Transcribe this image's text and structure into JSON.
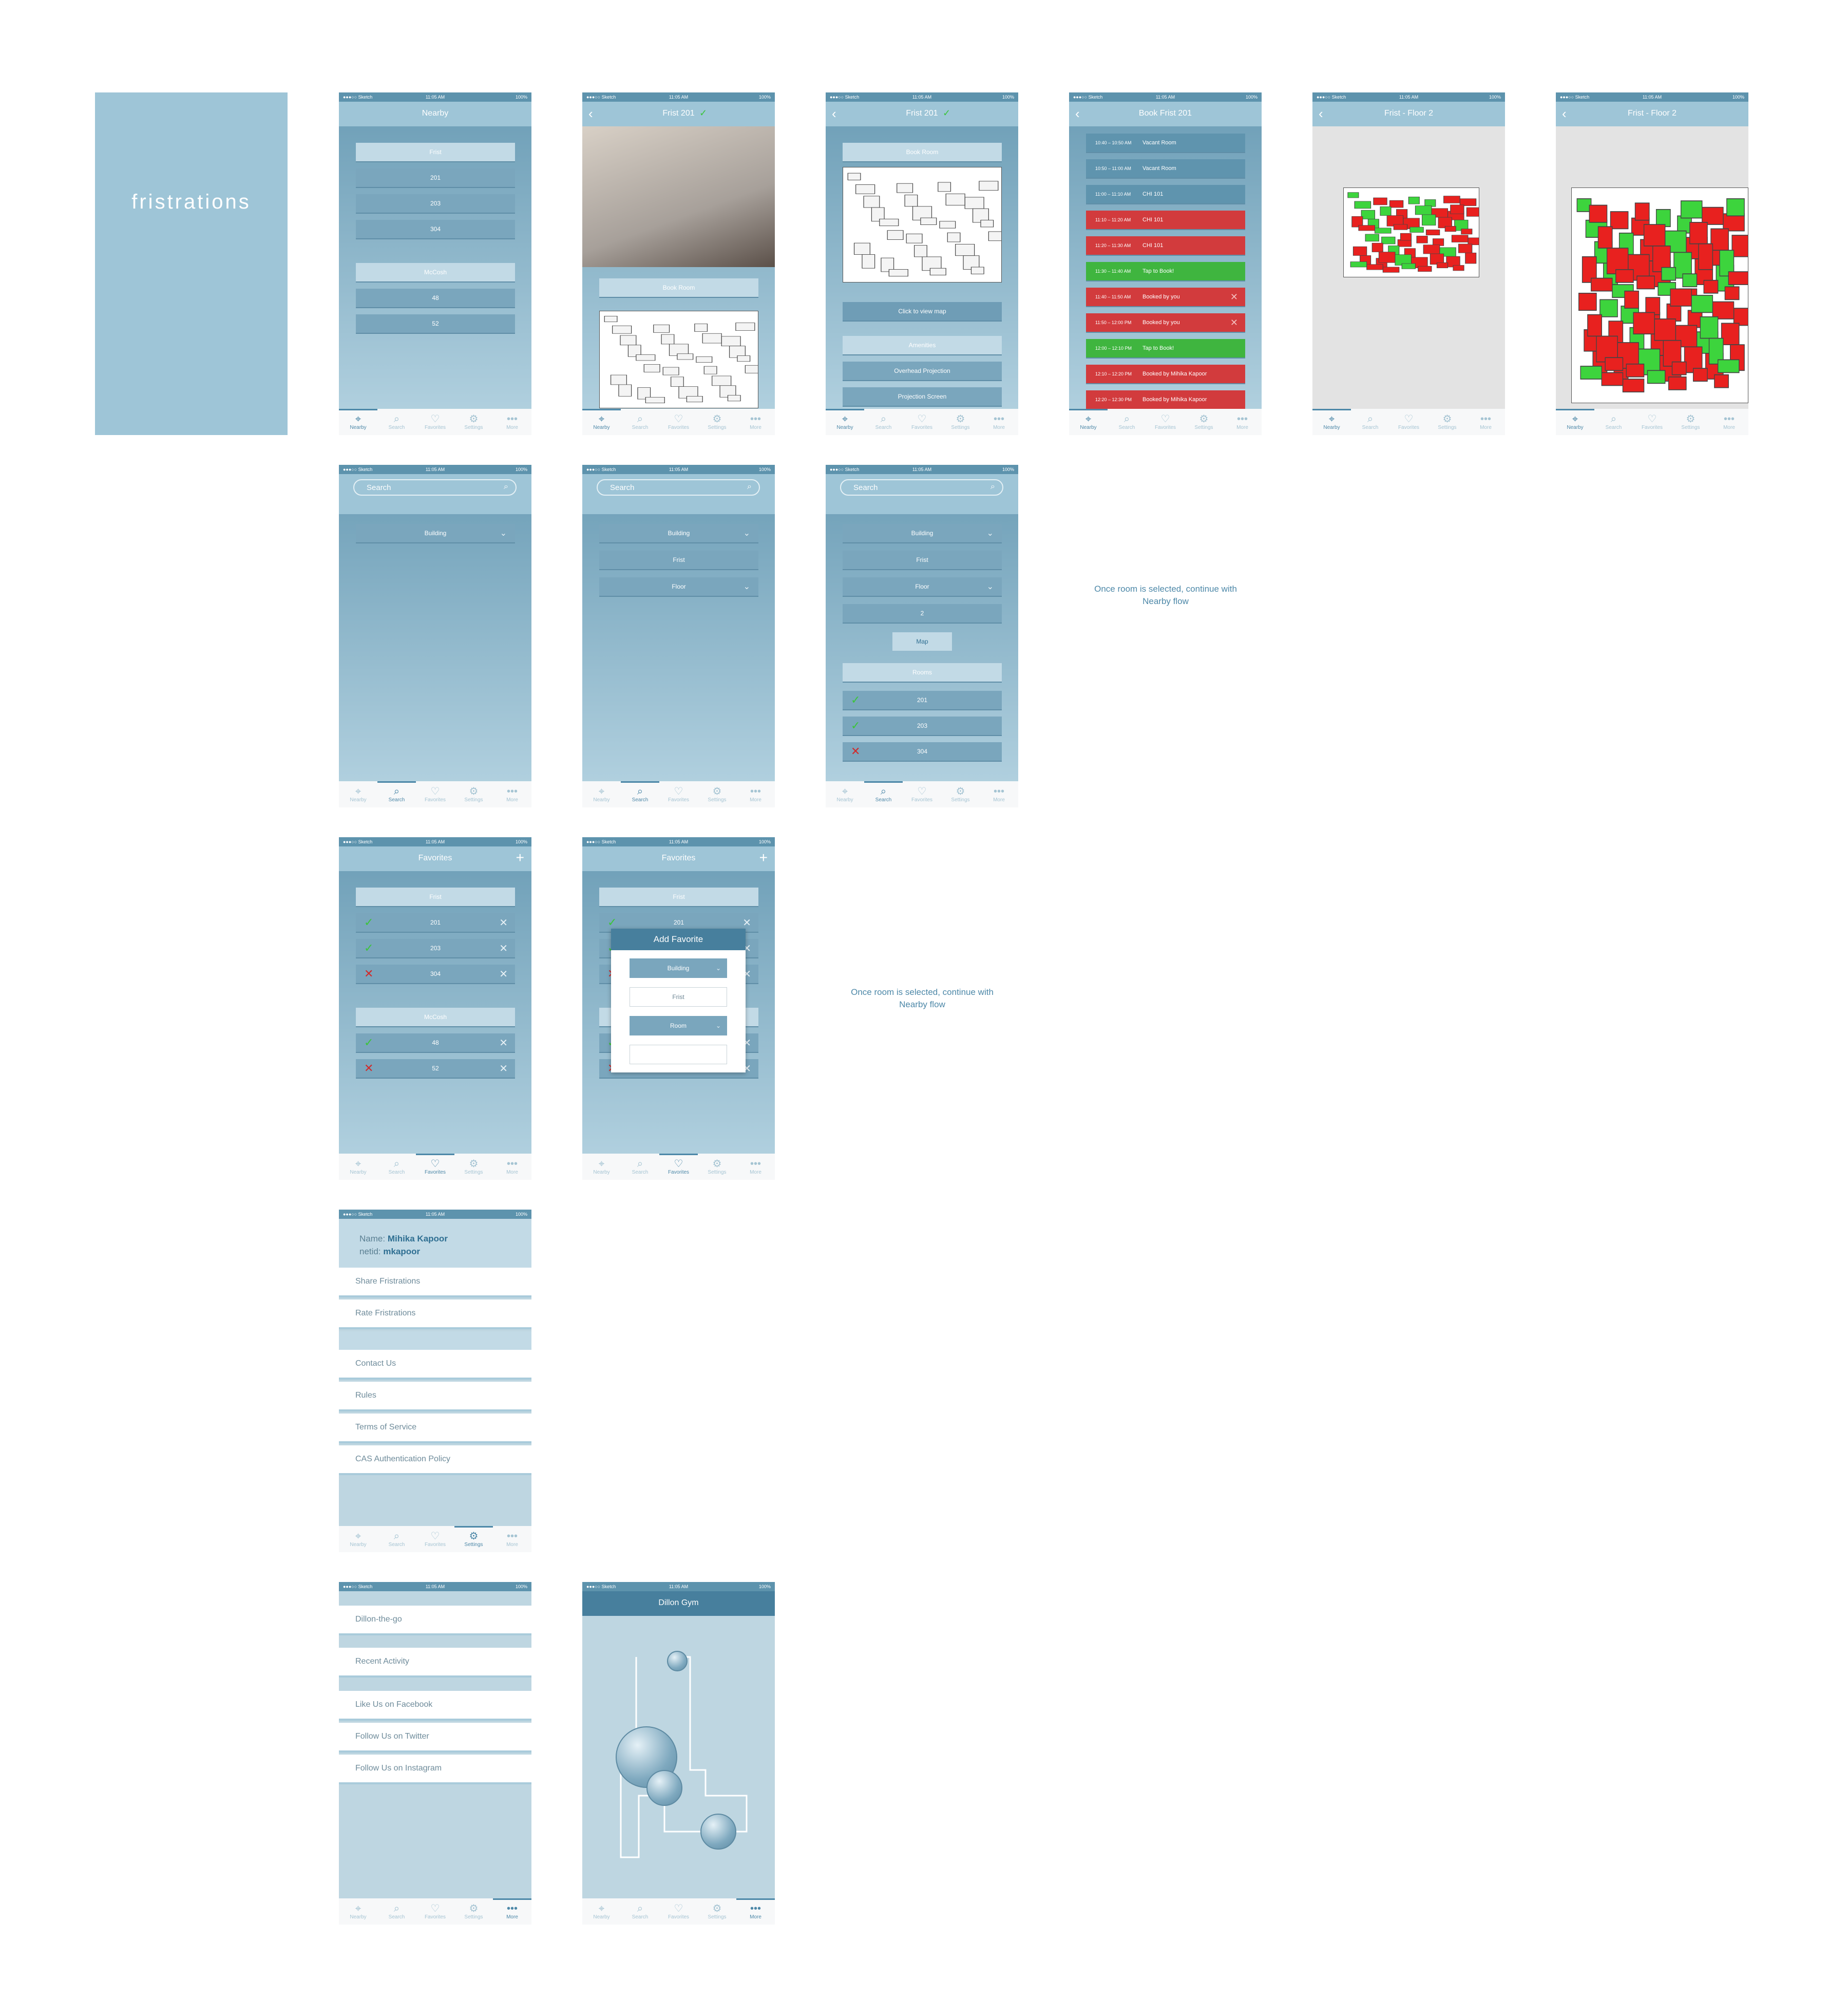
{
  "brand": {
    "splash_title": "fristrations",
    "accent": "#9ec5d7",
    "dark": "#477f9d",
    "booked_red": "#d23b3d",
    "open_green": "#3fb53f"
  },
  "status_bar": {
    "carrier": "●●●○○ Sketch",
    "time": "11:05 AM",
    "battery": "100%"
  },
  "tabs": [
    {
      "label": "Nearby",
      "icon": "map-pin-icon"
    },
    {
      "label": "Search",
      "icon": "search-icon"
    },
    {
      "label": "Favorites",
      "icon": "heart-icon"
    },
    {
      "label": "Settings",
      "icon": "gear-icon"
    },
    {
      "label": "More",
      "icon": "more-icon"
    }
  ],
  "nearby": {
    "title": "Nearby",
    "buildings": [
      {
        "name": "Frist",
        "rooms": [
          "201",
          "203",
          "304"
        ]
      },
      {
        "name": "McCosh",
        "rooms": [
          "48",
          "52"
        ]
      }
    ]
  },
  "room": {
    "title": "Frist 201",
    "book": "Book Room",
    "view_map": "Click to view map",
    "amenities_header": "Amenities",
    "amenities": [
      "Overhead Projection",
      "Projection Screen"
    ]
  },
  "booking": {
    "title": "Book Frist 201",
    "slots": [
      {
        "time": "10:40 – 10:50 AM",
        "label": "Vacant Room",
        "state": "vacant"
      },
      {
        "time": "10:50 – 11:00 AM",
        "label": "Vacant Room",
        "state": "vacant"
      },
      {
        "time": "11:00 – 11:10 AM",
        "label": "CHI 101",
        "state": "vacant"
      },
      {
        "time": "11:10 – 11:20 AM",
        "label": "CHI 101",
        "state": "booked"
      },
      {
        "time": "11:20 – 11:30 AM",
        "label": "CHI 101",
        "state": "booked"
      },
      {
        "time": "11:30 – 11:40 AM",
        "label": "Tap to Book!",
        "state": "open"
      },
      {
        "time": "11:40 – 11:50 AM",
        "label": "Booked by you",
        "state": "mine"
      },
      {
        "time": "11:50 – 12:00 PM",
        "label": "Booked by you",
        "state": "mine"
      },
      {
        "time": "12:00 – 12:10 PM",
        "label": "Tap to Book!",
        "state": "open"
      },
      {
        "time": "12:10 – 12:20 PM",
        "label": "Booked by Mihika Kapoor",
        "state": "booked"
      },
      {
        "time": "12:20 – 12:30 PM",
        "label": "Booked by Mihika Kapoor",
        "state": "booked"
      }
    ]
  },
  "floor_map": {
    "title": "Frist - Floor 2"
  },
  "search": {
    "placeholder": "Search",
    "building": "Building",
    "building_value": "Frist",
    "floor": "Floor",
    "floor_value": "2",
    "map": "Map",
    "rooms_header": "Rooms",
    "rooms": [
      {
        "name": "201",
        "available": true
      },
      {
        "name": "203",
        "available": true
      },
      {
        "name": "304",
        "available": false
      }
    ]
  },
  "notes": {
    "search": "Once room is selected, continue with Nearby flow",
    "favorites": "Once room is selected, continue with Nearby flow"
  },
  "favorites": {
    "title": "Favorites",
    "groups": [
      {
        "name": "Frist",
        "rooms": [
          {
            "name": "201",
            "available": true
          },
          {
            "name": "203",
            "available": true
          },
          {
            "name": "304",
            "available": false
          }
        ]
      },
      {
        "name": "McCosh",
        "rooms": [
          {
            "name": "48",
            "available": true
          },
          {
            "name": "52",
            "available": false
          }
        ]
      }
    ]
  },
  "add_favorite": {
    "title": "Add Favorite",
    "building": "Building",
    "building_value": "Frist",
    "room": "Room",
    "room_value": ""
  },
  "settings": {
    "name_label": "Name:",
    "name": "Mihika Kapoor",
    "netid_label": "netid:",
    "netid": "mkapoor",
    "items_a": [
      "Share Fristrations",
      "Rate Fristrations"
    ],
    "items_b": [
      "Contact Us",
      "Rules",
      "Terms of Service",
      "CAS Authentication Policy"
    ]
  },
  "more": {
    "items": [
      "Dillon-the-go",
      "Recent Activity",
      "Like Us on Facebook",
      "Follow Us on Twitter",
      "Follow Us on Instagram"
    ]
  },
  "gym": {
    "title": "Dillon Gym"
  }
}
